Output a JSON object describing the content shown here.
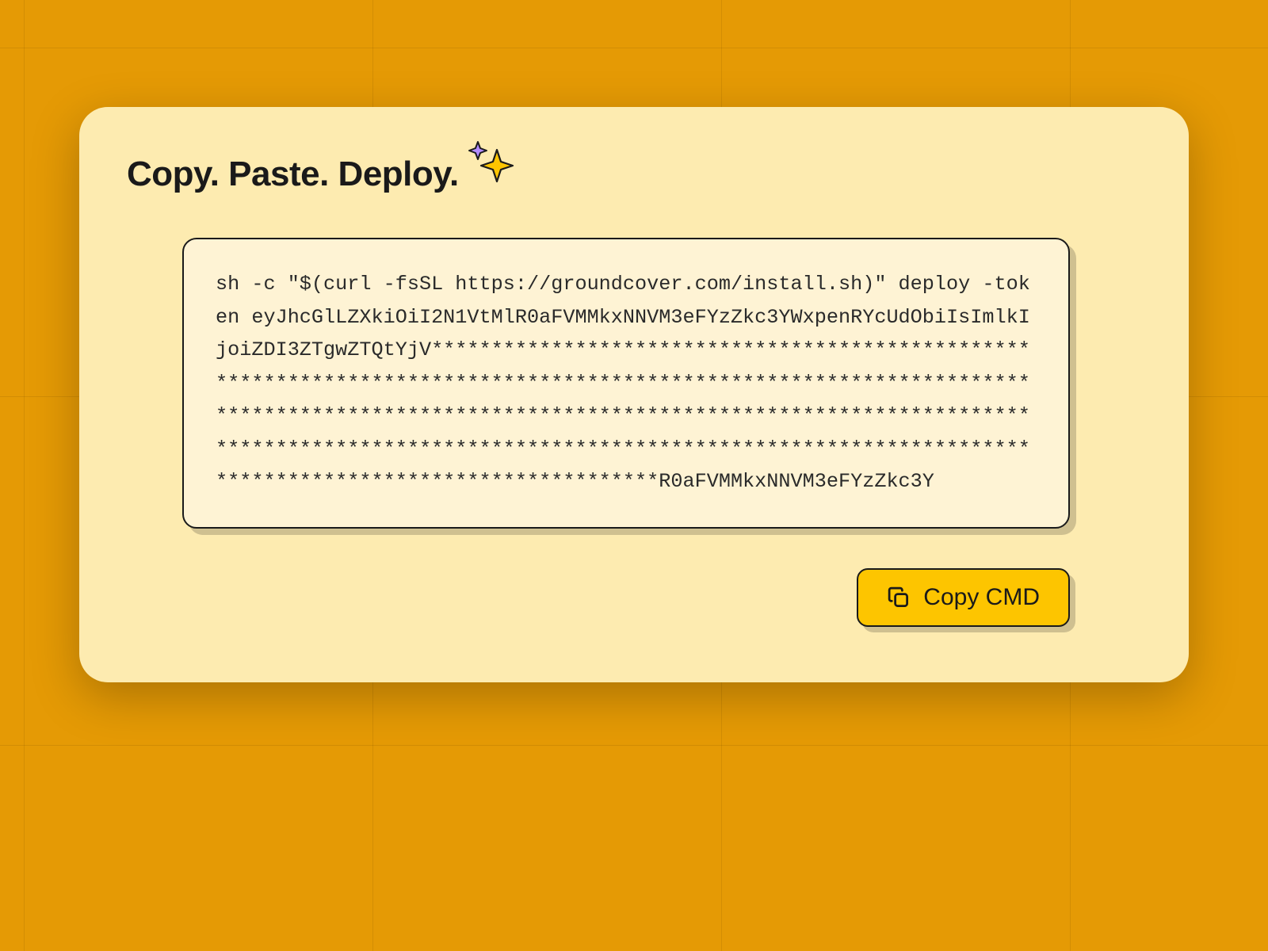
{
  "title": "Copy. Paste. Deploy.",
  "command": "sh -c \"$(curl -fsSL https://groundcover.com/install.sh)\" deploy -token eyJhcGlLZXkiOiI2N1VtMlR0aFVMMkxNNVM3eFYzZkc3YWxpenRYcUdObiIsImlkIjoiZDI3ZTgwZTQtYjV***************************************************************************************************************************************************************************************************************************************************************************************************R0aFVMMkxNNVM3eFYzZkc3Y",
  "action": {
    "copy_label": "Copy CMD"
  },
  "colors": {
    "background": "#E59A05",
    "card": "#FDEBB0",
    "code_bg": "#FEF3D4",
    "button": "#FDC500",
    "border": "#1a1a1a"
  }
}
